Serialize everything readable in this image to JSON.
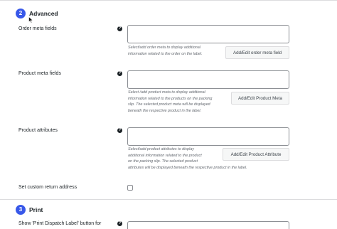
{
  "sections": {
    "advanced": {
      "number": "2",
      "title": "Advanced"
    },
    "print": {
      "number": "3",
      "title": "Print"
    }
  },
  "rows": {
    "order_meta": {
      "label": "Order meta fields",
      "description": [
        "Select/add order meta to display additional",
        "information related to the order on the label."
      ],
      "button": "Add/Edit order meta field"
    },
    "product_meta": {
      "label": "Product meta fields",
      "description": [
        "Select /add product meta to display additional",
        "information related to the products on the packing",
        "slip. The selected product meta will be displayed",
        "beneath the respective product in the label."
      ],
      "button": "Add/Edit Product Meta"
    },
    "product_attributes": {
      "label": "Product attributes",
      "description": [
        "Select/add product attributes to display",
        "additional information related to the product",
        "on the packing slip. The selected product",
        "attributes will be displayed beneath the respective product in the label."
      ],
      "button": "Add/Edit Product Attribute"
    },
    "return_address": {
      "label": "Set custom return address",
      "checked": false
    },
    "print_dispatch": {
      "label": "Show 'Print Dispatch Label' button for"
    }
  },
  "icons": {
    "help": "question-circle-icon",
    "cursor": "mouse-pointer-icon"
  },
  "colors": {
    "accent": "#3858e9"
  }
}
